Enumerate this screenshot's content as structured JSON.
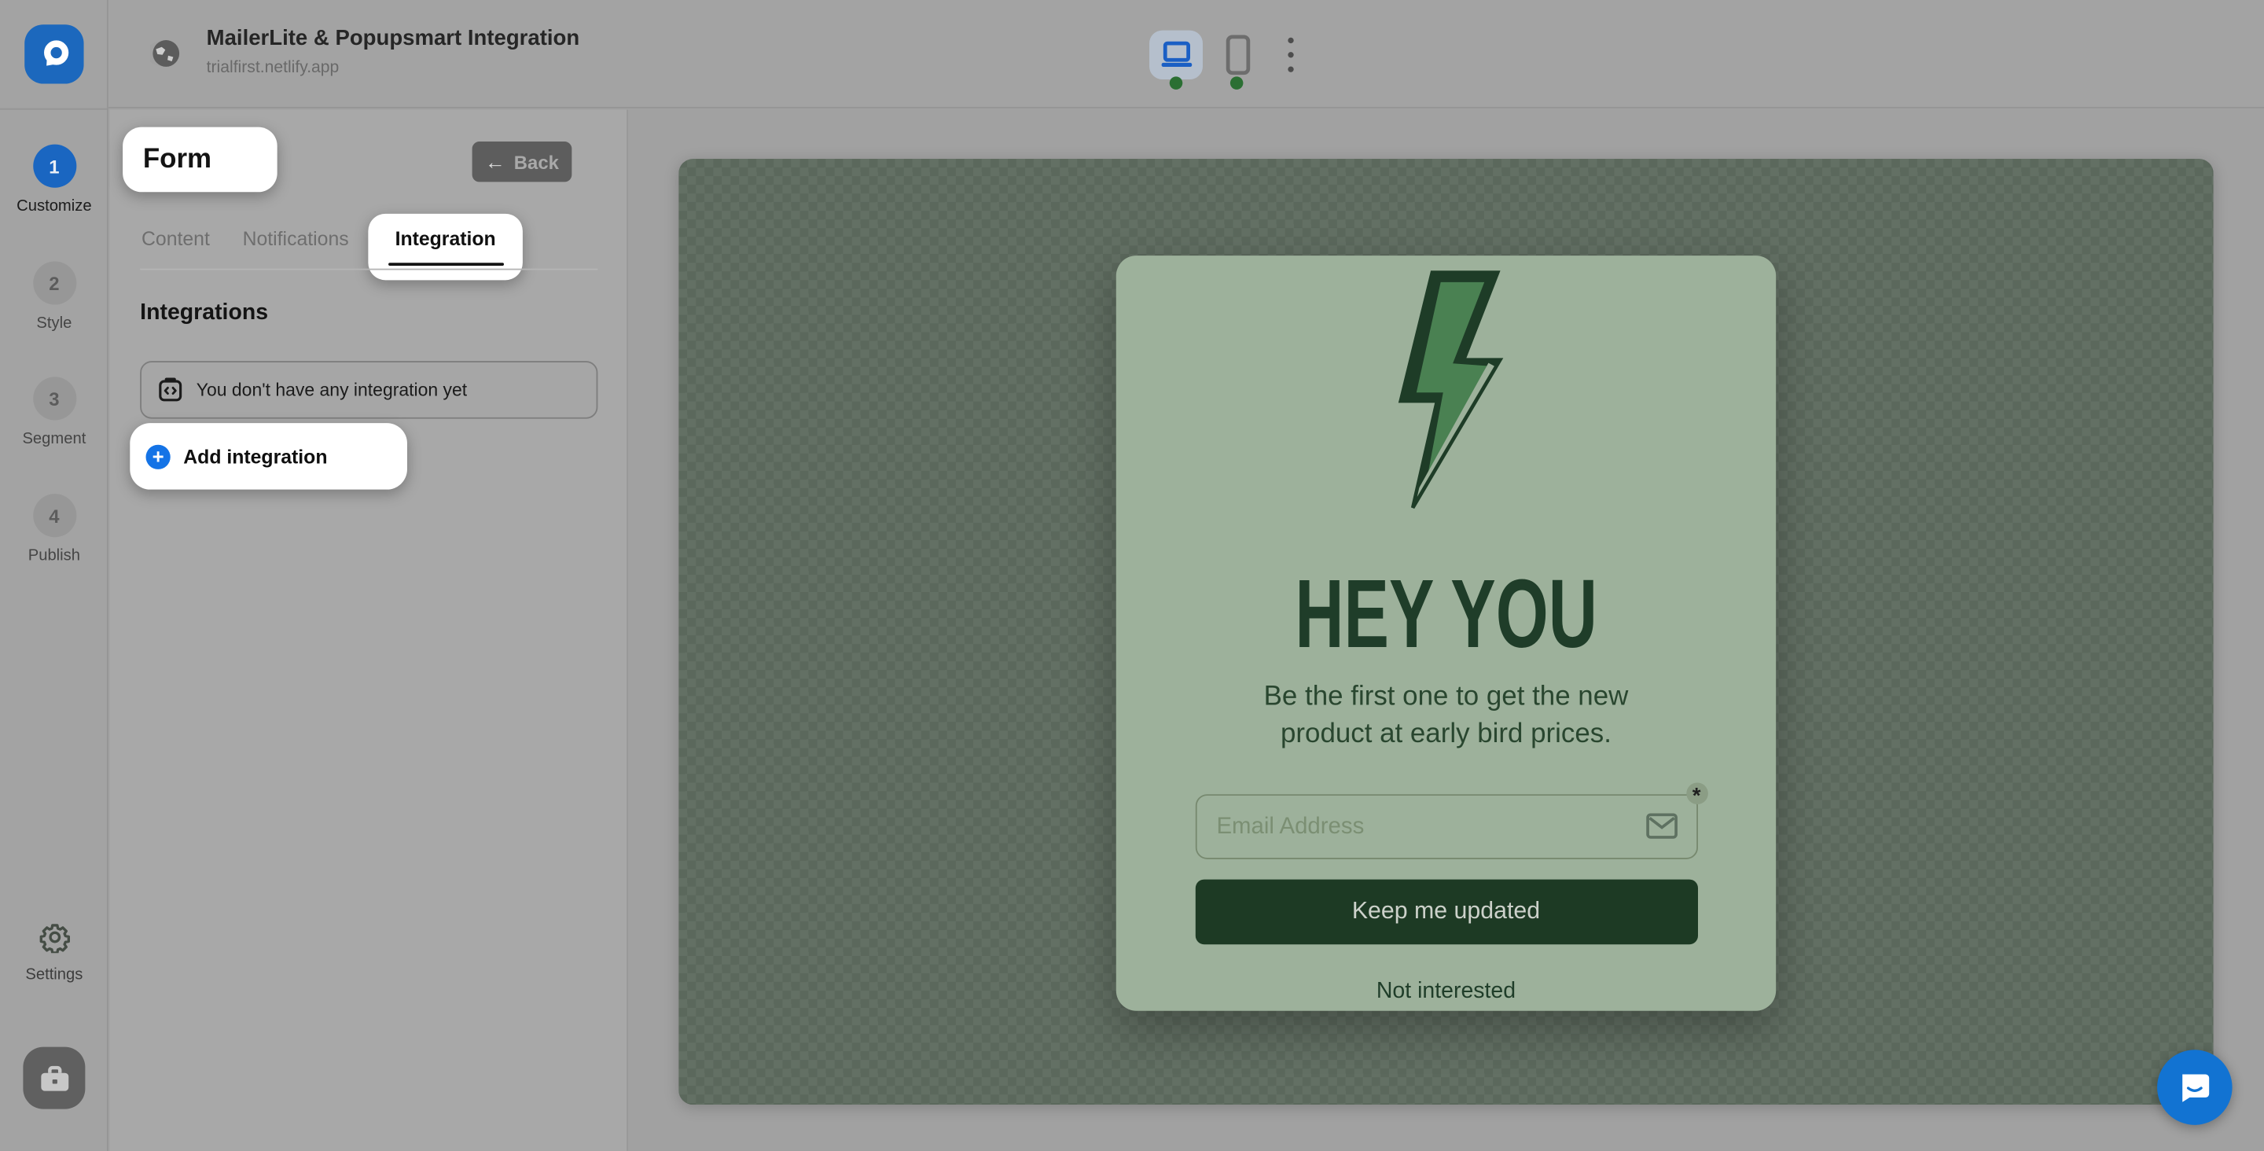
{
  "header": {
    "title": "MailerLite & Popupsmart Integration",
    "url": "trialfirst.netlify.app"
  },
  "sidebar": {
    "steps": [
      {
        "num": "1",
        "label": "Customize",
        "active": true
      },
      {
        "num": "2",
        "label": "Style",
        "active": false
      },
      {
        "num": "3",
        "label": "Segment",
        "active": false
      },
      {
        "num": "4",
        "label": "Publish",
        "active": false
      }
    ],
    "settings_label": "Settings"
  },
  "panel": {
    "title": "Form",
    "back_label": "Back",
    "tabs": [
      {
        "label": "Content",
        "active": false
      },
      {
        "label": "Notifications",
        "active": false
      },
      {
        "label": "Integration",
        "active": true
      }
    ],
    "section_title": "Integrations",
    "empty_message": "You don't have any integration yet",
    "add_label": "Add integration"
  },
  "popup": {
    "heading": "HEY YOU",
    "subtitle": "Be the first one to get the new product at early bird prices.",
    "email_placeholder": "Email Address",
    "submit_label": "Keep me updated",
    "dismiss_label": "Not interested",
    "required_marker": "*"
  },
  "icons": {
    "back_arrow": "←",
    "plus": "+"
  },
  "colors": {
    "accent_blue": "#1473e6",
    "step_active_blue": "#1a66c1",
    "popup_bg": "#9db19b",
    "popup_dark_green": "#1d3a24",
    "preview_backdrop": "#5b685c",
    "chat_blue": "#1273d2",
    "live_dot_green": "#2b6f33"
  }
}
